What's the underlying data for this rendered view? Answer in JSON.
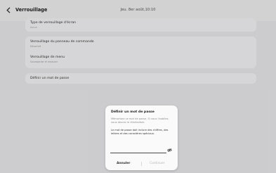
{
  "header": {
    "title": "Verrouillage",
    "datetime": "Jeu. 8er août,10:10"
  },
  "settings": {
    "lock_type": {
      "label": "Type de verrouillage d'écran",
      "value": "Aucun"
    },
    "control_panel_lock": {
      "label": "Verrouillage du panneau de commande",
      "value": "Désactivé"
    },
    "menu_lock": {
      "label": "Verrouillage de menu",
      "value": "Sauvegarder et restaurer"
    },
    "set_password": {
      "label": "Définir un mot de passe"
    }
  },
  "dialog": {
    "title": "Définir un mot de passe",
    "message": "Mémorisez ce mot de passe. Si vous l'oubliez, vous devrez le réinitialiser.",
    "rule": "Le mot de passe doit inclure des chiffres, des lettres et des caractères spéciaux.",
    "password_value": "",
    "cancel_label": "Annuler",
    "continue_label": "Continuer",
    "visibility_icon": "eye-slash-icon"
  }
}
